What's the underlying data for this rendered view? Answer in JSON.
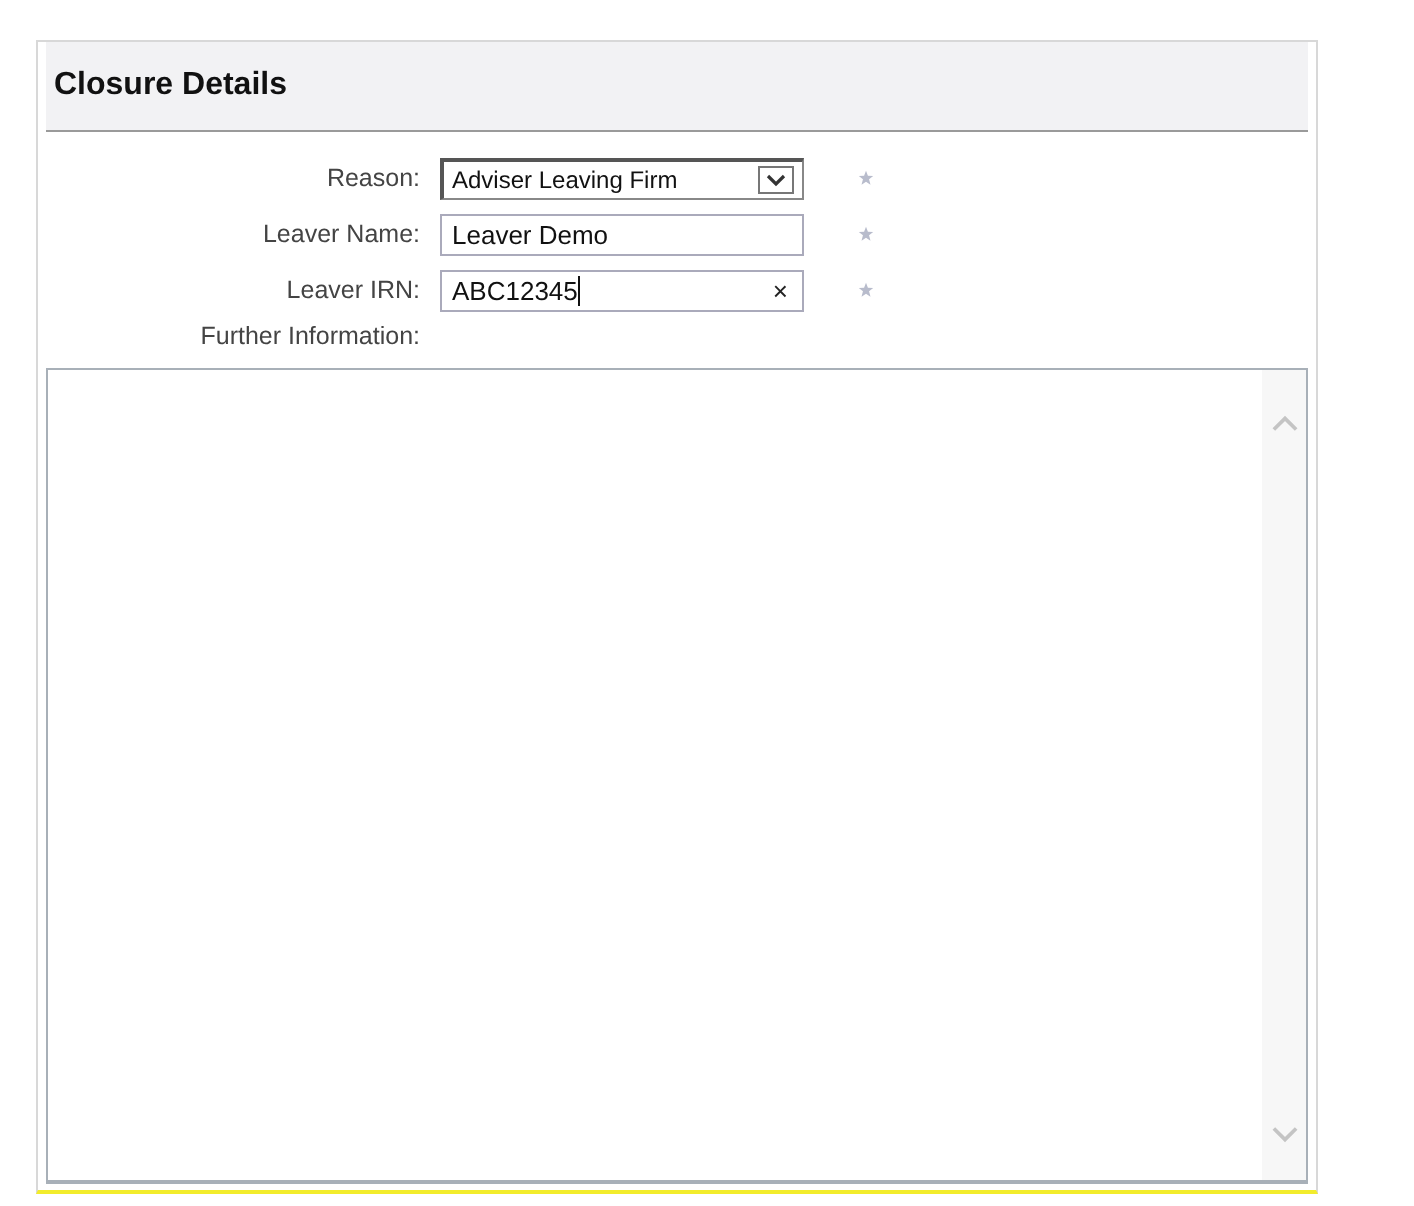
{
  "panel": {
    "title": "Closure Details",
    "fields": [
      {
        "kind": "select",
        "label": "Reason:",
        "value": "Adviser Leaving Firm",
        "required": true
      },
      {
        "kind": "text",
        "label": "Leaver Name:",
        "value": "Leaver Demo",
        "required": true
      },
      {
        "kind": "text",
        "label": "Leaver IRN:",
        "value": "ABC12345",
        "required": true,
        "clear": "×"
      }
    ],
    "notes": {
      "label": "Further Information:"
    }
  }
}
